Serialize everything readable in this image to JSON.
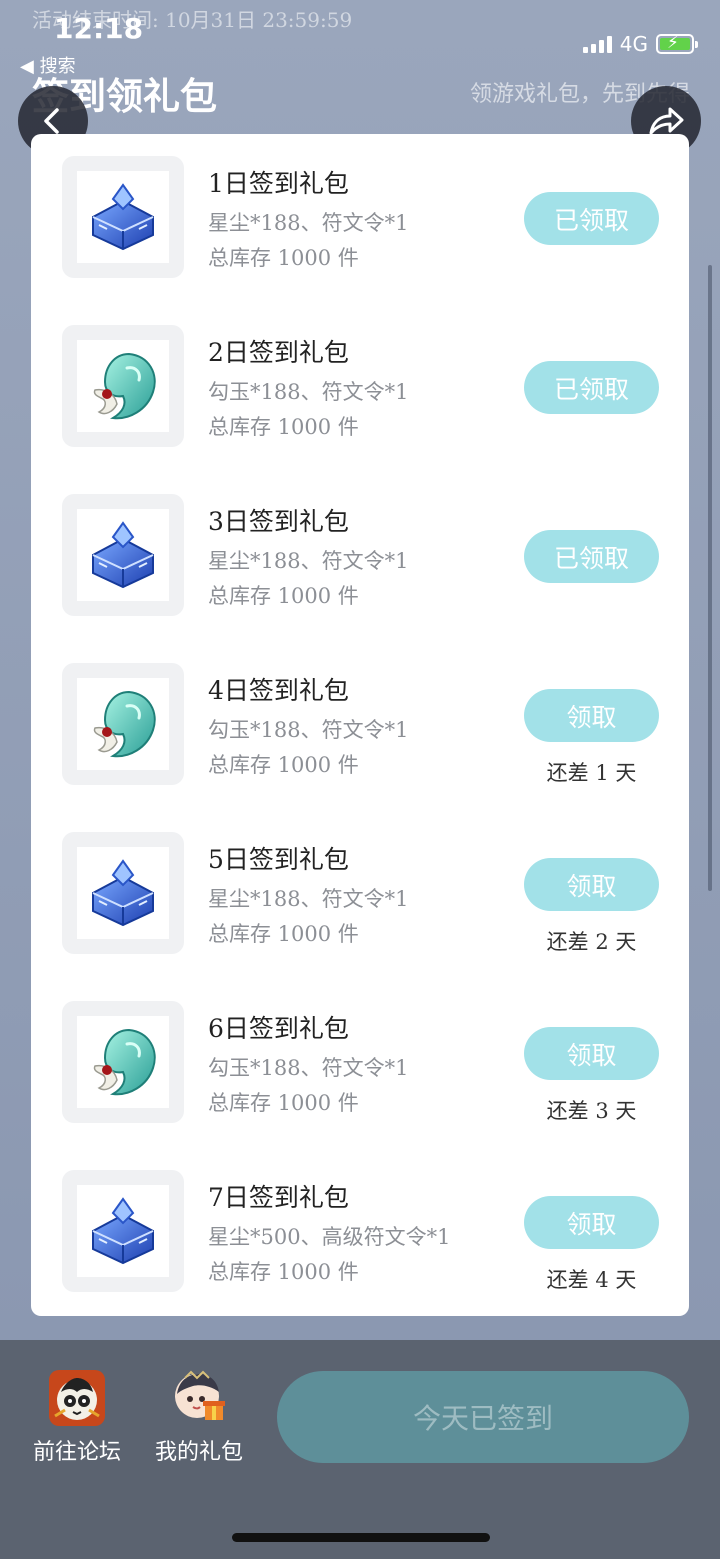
{
  "status_bar": {
    "time": "12:18",
    "back_label": "◀ 搜索",
    "network": "4G"
  },
  "header": {
    "activity_end": "活动结束时间: 10月31日 23:59:59",
    "title": "签到领礼包",
    "subtitle": "领游戏礼包，先到先得"
  },
  "icons": {
    "back": "chevron-left-icon",
    "share": "share-arrow-icon",
    "gift_star_dust": "crystal-chest-icon",
    "gift_magatama": "jade-magatama-icon"
  },
  "gifts": [
    {
      "name": "1日签到礼包",
      "desc": "星尘*188、符文令*1",
      "stock": "总库存 1000 件",
      "button": "已领取",
      "days_left": "",
      "icon": "crystal"
    },
    {
      "name": "2日签到礼包",
      "desc": "勾玉*188、符文令*1",
      "stock": "总库存 1000 件",
      "button": "已领取",
      "days_left": "",
      "icon": "magatama"
    },
    {
      "name": "3日签到礼包",
      "desc": "星尘*188、符文令*1",
      "stock": "总库存 1000 件",
      "button": "已领取",
      "days_left": "",
      "icon": "crystal"
    },
    {
      "name": "4日签到礼包",
      "desc": "勾玉*188、符文令*1",
      "stock": "总库存 1000 件",
      "button": "领取",
      "days_left": "还差 1 天",
      "icon": "magatama"
    },
    {
      "name": "5日签到礼包",
      "desc": "星尘*188、符文令*1",
      "stock": "总库存 1000 件",
      "button": "领取",
      "days_left": "还差 2 天",
      "icon": "crystal"
    },
    {
      "name": "6日签到礼包",
      "desc": "勾玉*188、符文令*1",
      "stock": "总库存 1000 件",
      "button": "领取",
      "days_left": "还差 3 天",
      "icon": "magatama"
    },
    {
      "name": "7日签到礼包",
      "desc": "星尘*500、高级符文令*1",
      "stock": "总库存 1000 件",
      "button": "领取",
      "days_left": "还差 4 天",
      "icon": "crystal"
    }
  ],
  "bottom_bar": {
    "forum_label": "前往论坛",
    "my_gifts_label": "我的礼包",
    "signin_label": "今天已签到"
  },
  "colors": {
    "claim_button": "#a2e1e8",
    "signin_button": "#5e8f99",
    "page_background": "#8e9bb3"
  }
}
